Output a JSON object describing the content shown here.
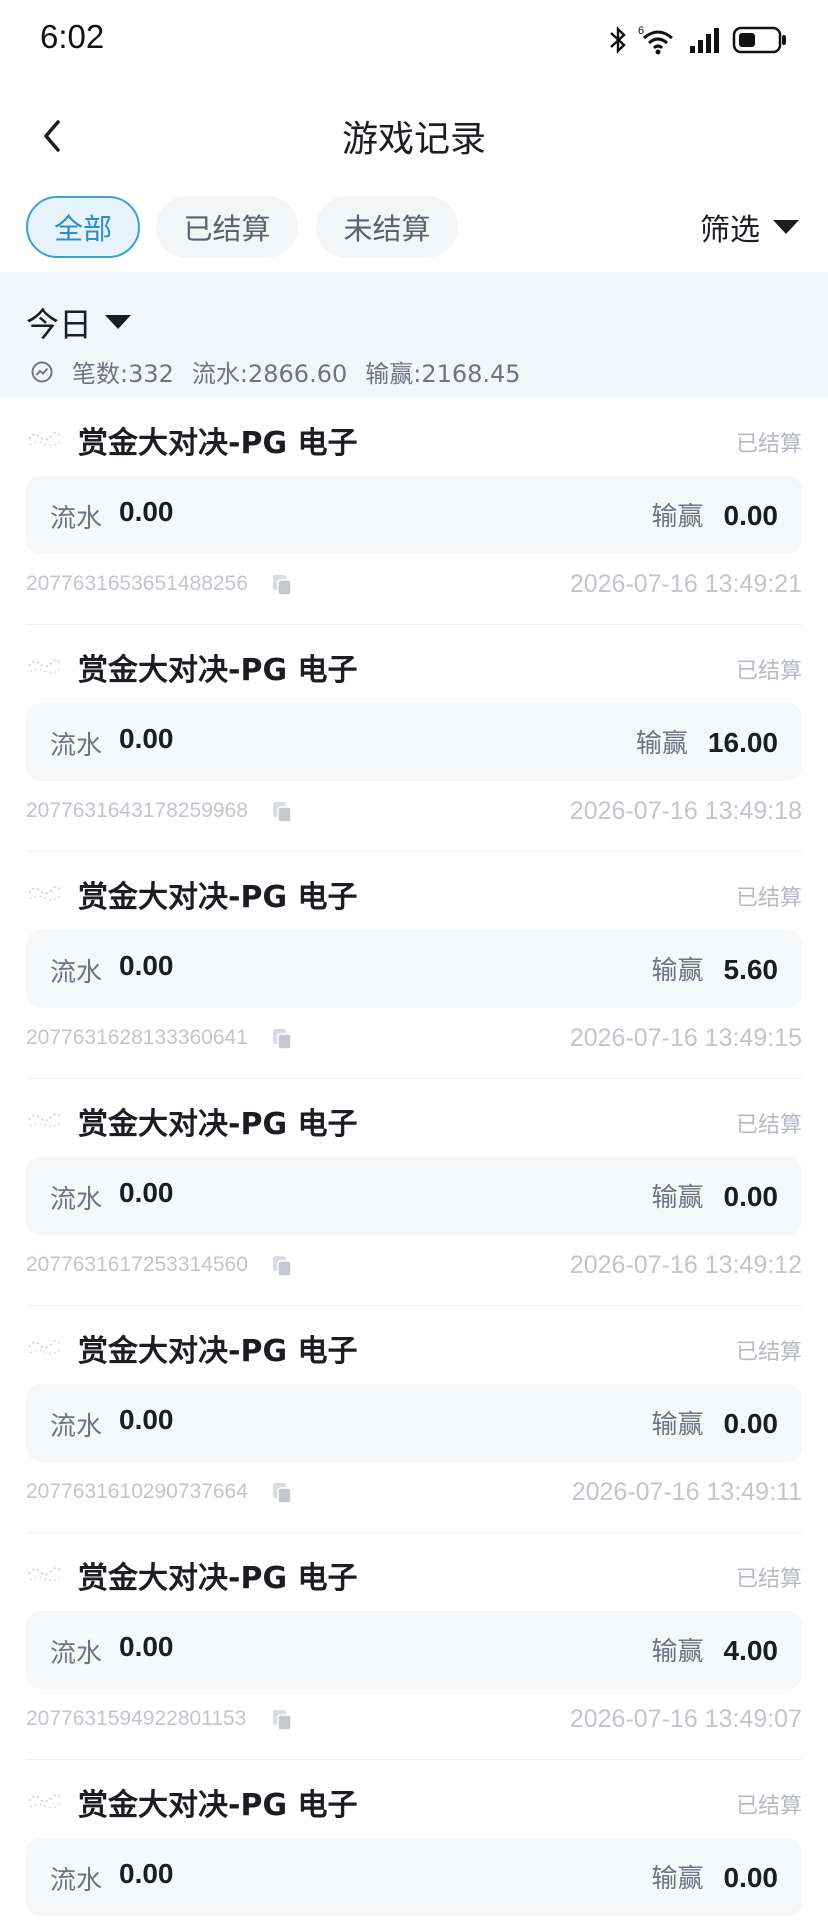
{
  "status_bar": {
    "time": "6:02",
    "icons": [
      "bluetooth-icon",
      "wifi-6-icon",
      "signal-icon",
      "battery-icon"
    ]
  },
  "nav": {
    "back_icon": "chevron-left-icon",
    "title": "游戏记录"
  },
  "tabs": [
    {
      "label": "全部",
      "active": true
    },
    {
      "label": "已结算",
      "active": false
    },
    {
      "label": "未结算",
      "active": false
    }
  ],
  "filter": {
    "label": "筛选",
    "icon": "caret-down-icon"
  },
  "summary": {
    "date_label": "今日",
    "stat_icon": "chart-icon",
    "count_text": "笔数:332",
    "turnover_text": "流水:2866.60",
    "winloss_text": "输赢:2168.45"
  },
  "labels": {
    "turnover": "流水",
    "winloss": "输赢"
  },
  "records": [
    {
      "game": "赏金大对决-PG 电子",
      "status": "已结算",
      "turnover": "0.00",
      "winloss": "0.00",
      "order_id": "2077631653651488256",
      "time": "2026-07-16 13:49:21"
    },
    {
      "game": "赏金大对决-PG 电子",
      "status": "已结算",
      "turnover": "0.00",
      "winloss": "16.00",
      "order_id": "2077631643178259968",
      "time": "2026-07-16 13:49:18"
    },
    {
      "game": "赏金大对决-PG 电子",
      "status": "已结算",
      "turnover": "0.00",
      "winloss": "5.60",
      "order_id": "2077631628133360641",
      "time": "2026-07-16 13:49:15"
    },
    {
      "game": "赏金大对决-PG 电子",
      "status": "已结算",
      "turnover": "0.00",
      "winloss": "0.00",
      "order_id": "2077631617253314560",
      "time": "2026-07-16 13:49:12"
    },
    {
      "game": "赏金大对决-PG 电子",
      "status": "已结算",
      "turnover": "0.00",
      "winloss": "0.00",
      "order_id": "2077631610290737664",
      "time": "2026-07-16 13:49:11"
    },
    {
      "game": "赏金大对决-PG 电子",
      "status": "已结算",
      "turnover": "0.00",
      "winloss": "4.00",
      "order_id": "2077631594922801153",
      "time": "2026-07-16 13:49:07"
    },
    {
      "game": "赏金大对决-PG 电子",
      "status": "已结算",
      "turnover": "0.00",
      "winloss": "0.00",
      "order_id": "",
      "time": ""
    }
  ],
  "colors": {
    "accent": "#3aa0d8",
    "summary_bg": "#f1f6fb"
  }
}
